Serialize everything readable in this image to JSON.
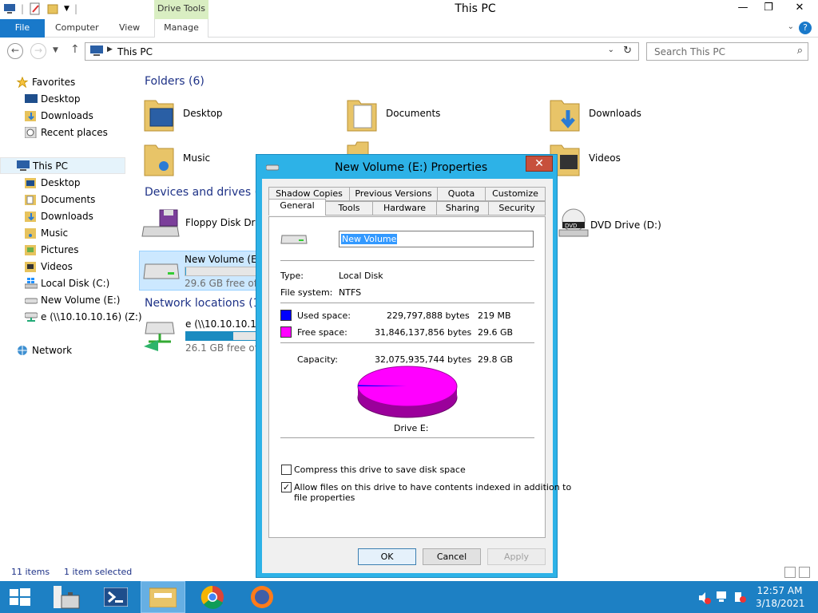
{
  "window": {
    "title": "This PC",
    "context_tab": "Drive Tools"
  },
  "ribbon": {
    "file": "File",
    "tabs": [
      "Computer",
      "View",
      "Manage"
    ],
    "help": "?"
  },
  "address": {
    "crumb": "This PC",
    "search_placeholder": "Search This PC"
  },
  "nav": {
    "favorites": "Favorites",
    "fav_items": [
      "Desktop",
      "Downloads",
      "Recent places"
    ],
    "this_pc": "This PC",
    "pc_items": [
      "Desktop",
      "Documents",
      "Downloads",
      "Music",
      "Pictures",
      "Videos",
      "Local Disk (C:)",
      "New Volume (E:)",
      "e (\\\\10.10.10.16) (Z:)"
    ],
    "network": "Network"
  },
  "content": {
    "folders_header": "Folders (6)",
    "folders": [
      "Desktop",
      "Documents",
      "Downloads",
      "Music",
      "Videos"
    ],
    "devices_header": "Devices and drives (4",
    "floppy": "Floppy Disk Drive",
    "dvd": "DVD Drive (D:)",
    "newvol": {
      "name": "New Volume (E:)",
      "free": "29.6 GB free of 29",
      "fraction_used": 0.01
    },
    "network_header": "Network locations (1)",
    "netdrive": {
      "name": "e (\\\\10.10.10.16) (",
      "free": "26.1 GB free of 39",
      "fraction_used": 0.66
    }
  },
  "status": {
    "items": "11 items",
    "selected": "1 item selected"
  },
  "dialog": {
    "title": "New Volume (E:) Properties",
    "tabs_row1": [
      "Shadow Copies",
      "Previous Versions",
      "Quota",
      "Customize"
    ],
    "tabs_row2": [
      "General",
      "Tools",
      "Hardware",
      "Sharing",
      "Security"
    ],
    "volume_label": "New Volume",
    "type_label": "Type:",
    "type_value": "Local Disk",
    "fs_label": "File system:",
    "fs_value": "NTFS",
    "used_label": "Used space:",
    "used_bytes": "229,797,888 bytes",
    "used_size": "219 MB",
    "free_label": "Free space:",
    "free_bytes": "31,846,137,856 bytes",
    "free_size": "29.6 GB",
    "capacity_label": "Capacity:",
    "capacity_bytes": "32,075,935,744 bytes",
    "capacity_size": "29.8 GB",
    "drive_label": "Drive E:",
    "compress": "Compress this drive to save disk space",
    "index_line1": "Allow files on this drive to have contents indexed in addition to",
    "index_line2": "file properties",
    "ok": "OK",
    "cancel": "Cancel",
    "apply": "Apply",
    "colors": {
      "used": "#0000ff",
      "free": "#ff00ff"
    },
    "used_fraction": 0.0072
  },
  "taskbar": {
    "time": "12:57 AM",
    "date": "3/18/2021"
  }
}
